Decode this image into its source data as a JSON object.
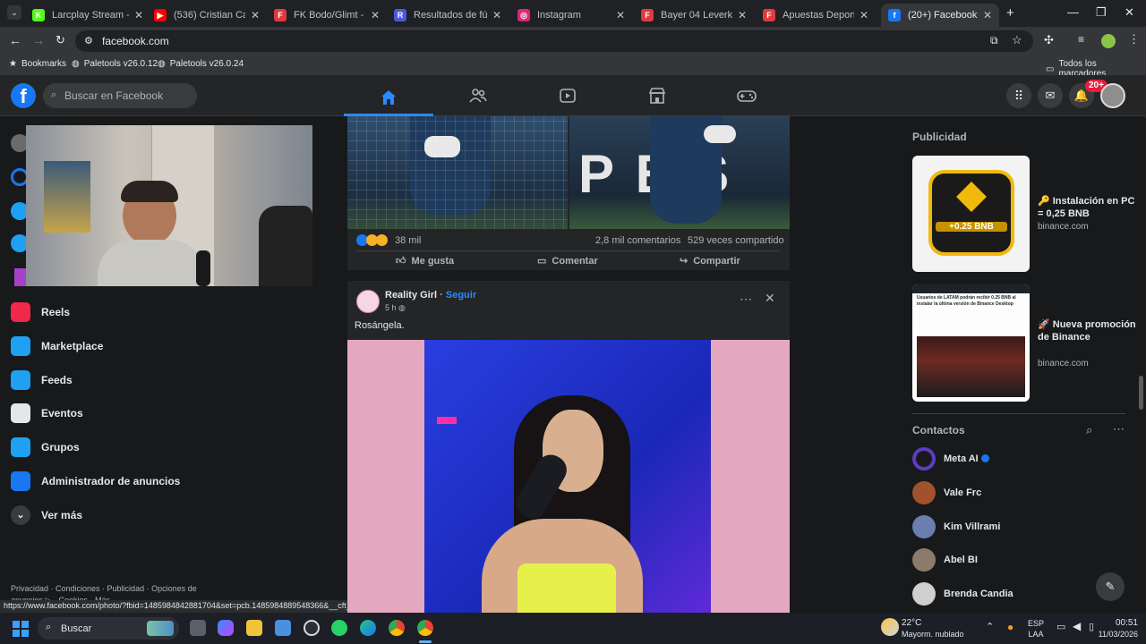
{
  "browser": {
    "tabs": [
      {
        "label": "Larcplay Stream - Wa",
        "favicon": "kick-icon",
        "color": "#53fc18",
        "glyph": "K"
      },
      {
        "label": "(536) Cristian Cast",
        "favicon": "youtube-icon",
        "color": "#ff0000",
        "glyph": "▶"
      },
      {
        "label": "FK Bodo/Glimt - Spor",
        "favicon": "flashscore-icon",
        "color": "#e03a3e",
        "glyph": "F"
      },
      {
        "label": "Resultados de fútbol",
        "favicon": "scores-icon",
        "color": "#4a5ad8",
        "glyph": "R"
      },
      {
        "label": "Instagram",
        "favicon": "instagram-icon",
        "color": "#d62976",
        "glyph": "◎"
      },
      {
        "label": "Bayer 04 Leverkusen",
        "favicon": "flashscore-icon",
        "color": "#e03a3e",
        "glyph": "F"
      },
      {
        "label": "Apuestas Deportivas",
        "favicon": "flashscore-icon",
        "color": "#e03a3e",
        "glyph": "F"
      },
      {
        "label": "(20+) Facebook",
        "favicon": "facebook-icon",
        "color": "#1877f2",
        "glyph": "f"
      }
    ],
    "url": "facebook.com",
    "bookmarks": {
      "label": "Bookmarks",
      "item1": "Paletools v26.0.12",
      "item2": "Paletools v26.0.24",
      "all": "Todos los marcadores"
    },
    "status_url": "https://www.facebook.com/photo/?fbid=1485984842881704&set=pcb.1485984889548366&__cft__[0]=AZ..."
  },
  "facebook": {
    "search_placeholder": "Buscar en Facebook",
    "notifications_badge": "20+",
    "sidebar": {
      "items": [
        {
          "label": "Reels",
          "icon": "reels-icon",
          "color": "#f02849"
        },
        {
          "label": "Marketplace",
          "icon": "marketplace-icon",
          "color": "#1ea1f2"
        },
        {
          "label": "Feeds",
          "icon": "feeds-icon",
          "color": "#1ea1f2"
        },
        {
          "label": "Eventos",
          "icon": "events-icon",
          "color": "#e4e6eb"
        },
        {
          "label": "Grupos",
          "icon": "groups-icon",
          "color": "#1ea1f2"
        },
        {
          "label": "Administrador de anuncios",
          "icon": "ads-manager-icon",
          "color": "#1877f2"
        },
        {
          "label": "Ver más",
          "icon": "chevron-down-icon",
          "color": "#e4e6eb"
        }
      ],
      "footer": "Privacidad · Condiciones · Publicidad · Opciones de anuncios ▷ · Cookies · Más"
    },
    "post1": {
      "reactions_count": "38 mil",
      "comments": "2,8 mil comentarios",
      "shares": "529 veces compartido",
      "like_label": "Me gusta",
      "comment_label": "Comentar",
      "share_label": "Compartir"
    },
    "post2": {
      "author": "Reality Girl",
      "dot": "·",
      "follow_label": "Seguir",
      "time": "5 h",
      "text": "Rosángela."
    },
    "right": {
      "ads_heading": "Publicidad",
      "ads": [
        {
          "title": "🔑 Instalación en PC = 0,25 BNB",
          "domain": "binance.com",
          "badge": "+0.25 BNB"
        },
        {
          "title": "🚀 Nueva promoción de Binance",
          "domain": "binance.com",
          "thumb_text": "Usuarios de LATAM podrán recibir 0.25 BNB al instalar la última versión de Binance Desktop"
        }
      ],
      "contacts_heading": "Contactos",
      "contacts": [
        {
          "name": "Meta AI",
          "avatar_color": "#5b3cc4"
        },
        {
          "name": "Vale Frc",
          "avatar_color": "#a0522d"
        },
        {
          "name": "Kim Villrami",
          "avatar_color": "#6a7fb0"
        },
        {
          "name": "Abel BI",
          "avatar_color": "#8c7a6b"
        },
        {
          "name": "Brenda Candia",
          "avatar_color": "#cfcfcf"
        }
      ]
    }
  },
  "taskbar": {
    "search_label": "Buscar",
    "weather_temp": "22°C",
    "weather_desc": "Mayorm. nublado",
    "lang1": "ESP",
    "lang2": "LAA",
    "time": "00:51",
    "date": "11/03/2026"
  },
  "colors": {
    "fb_blue": "#1877f2",
    "fb_dark": "#242526",
    "fb_bg": "#18191a"
  }
}
